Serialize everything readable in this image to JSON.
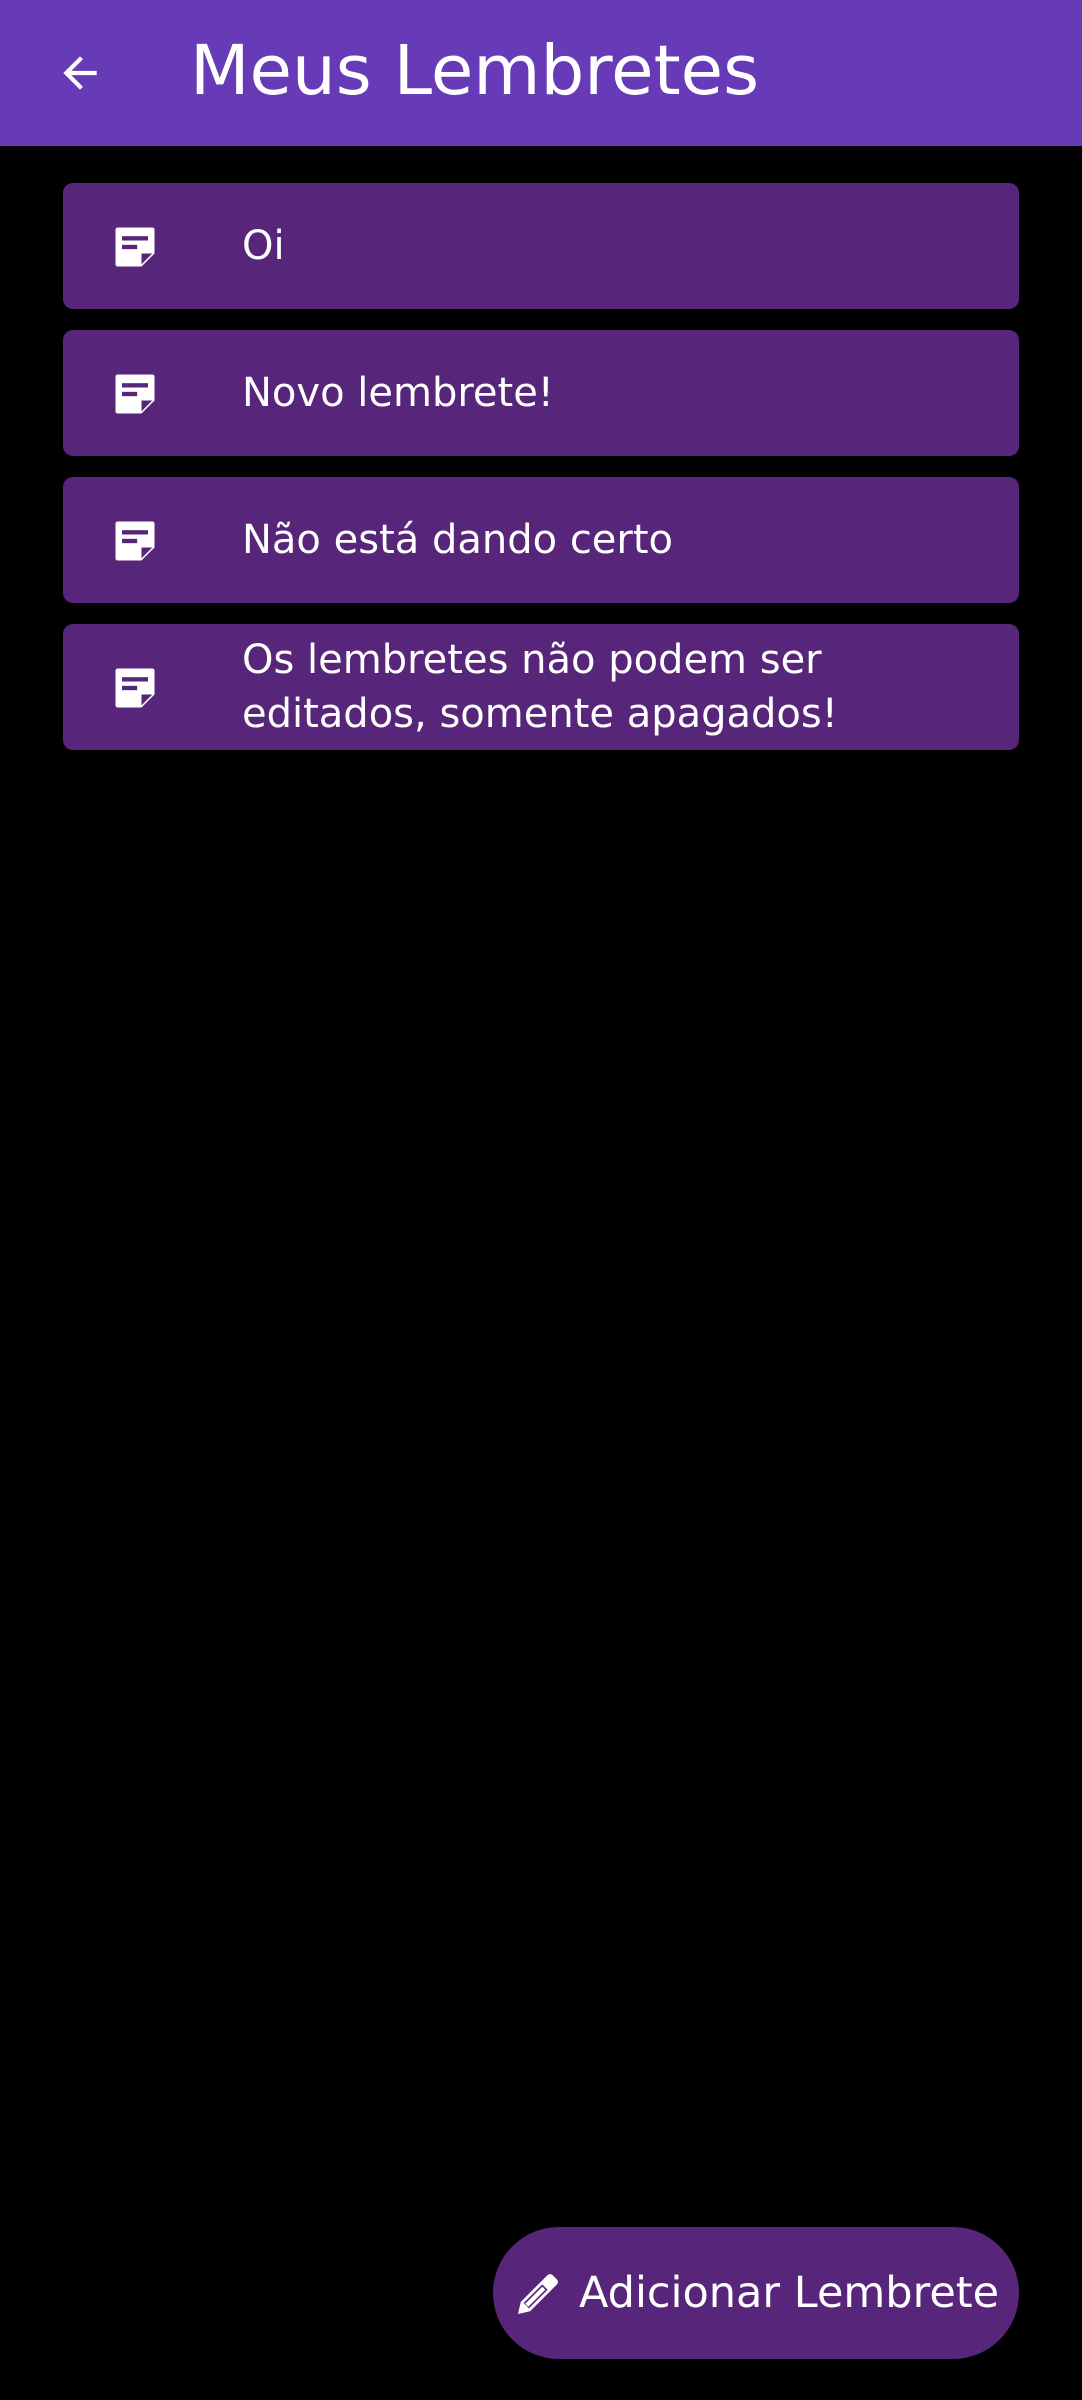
{
  "app_bar": {
    "title": "Meus Lembretes",
    "back_icon": "arrow-left-icon",
    "background_color": "#673AB7"
  },
  "reminders": [
    {
      "icon": "note-icon",
      "text": "Oi"
    },
    {
      "icon": "note-icon",
      "text": "Novo lembrete!"
    },
    {
      "icon": "note-icon",
      "text": "Não está dando certo"
    },
    {
      "icon": "note-icon",
      "text": "Os lembretes não podem ser editados, somente apagados!"
    }
  ],
  "fab": {
    "icon": "pencil-icon",
    "label": "Adicionar Lembrete"
  },
  "colors": {
    "card_background": "#57267A",
    "page_background": "#000000",
    "text": "#FFFFFF"
  }
}
